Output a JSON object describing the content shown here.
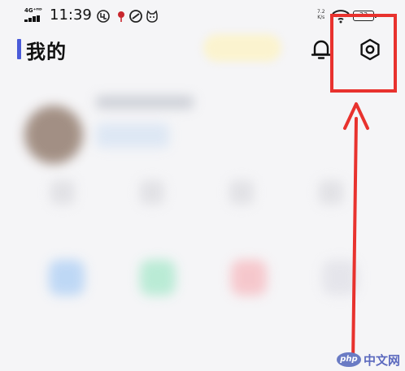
{
  "status_bar": {
    "network": "4G⁺ᴴᴰ",
    "time": "11:39",
    "speed_value": "7.2",
    "speed_unit": "K/s",
    "battery": "33"
  },
  "header": {
    "title": "我的"
  },
  "watermark": {
    "logo": "php",
    "text": "中文网"
  },
  "colors": {
    "accent": "#4a5bd9",
    "annotation": "#e8322e"
  },
  "icons": {
    "bell": "bell-icon",
    "settings": "settings-icon"
  }
}
